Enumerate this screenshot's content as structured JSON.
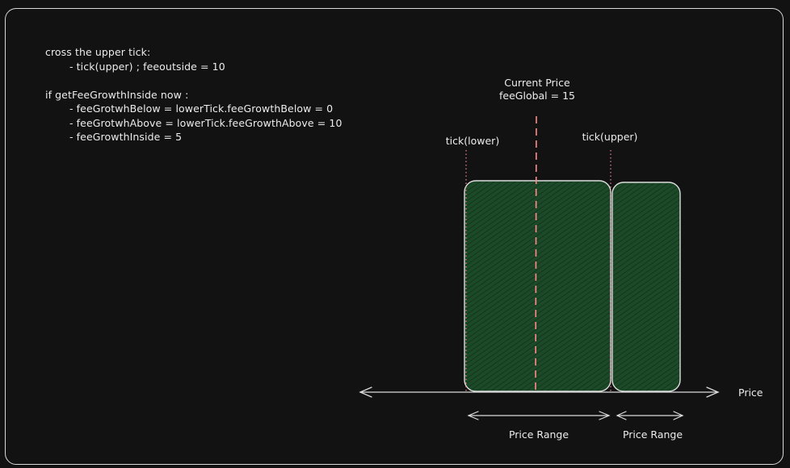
{
  "notes": {
    "line1": "cross the upper tick:",
    "line2": "- tick(upper) ; feeoutside = 10",
    "line3": "if getFeeGrowthInside now :",
    "line4": "- feeGrotwhBelow = lowerTick.feeGrowthBelow = 0",
    "line5": "- feeGrotwhAbove = lowerTick.feeGrowthAbove = 10",
    "line6": "- feeGrowthInside = 5"
  },
  "diagram": {
    "current_price_title": "Current Price",
    "fee_global": "feeGlobal = 15",
    "tick_lower": "tick(lower)",
    "tick_upper": "tick(upper)",
    "axis_label": "Price",
    "range_label_1": "Price Range",
    "range_label_2": "Price Range"
  },
  "colors": {
    "background": "#121212",
    "range_fill": "#1c4a28",
    "current_price_line": "#ff8a8a",
    "tick_line": "#ff8fa0",
    "stroke": "#dcdcdc"
  }
}
